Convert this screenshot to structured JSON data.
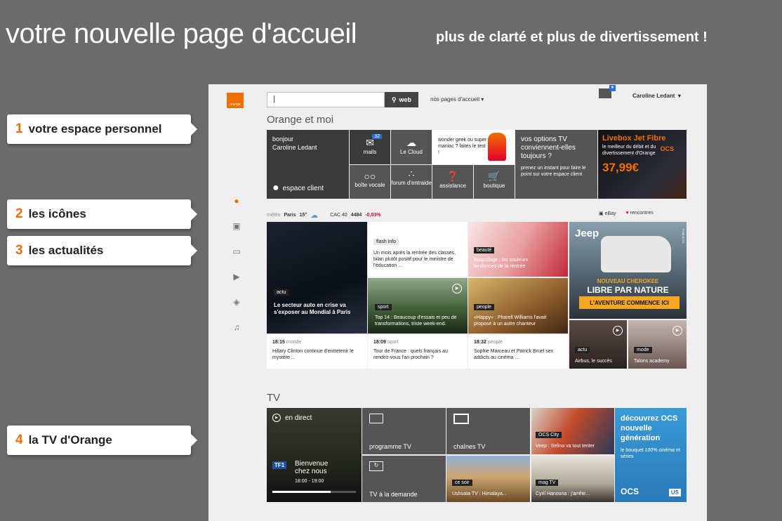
{
  "promo": {
    "title": "votre nouvelle page d'accueil",
    "subtitle": "plus de clarté et plus de divertissement !"
  },
  "callouts": [
    {
      "num": "1",
      "label": "votre espace personnel"
    },
    {
      "num": "2",
      "label": "les icônes"
    },
    {
      "num": "3",
      "label": "les actualités"
    },
    {
      "num": "4",
      "label": "la TV d'Orange"
    }
  ],
  "header": {
    "logo_text": "orange",
    "search_button": "web",
    "my_pages": "nos pages d'accueil",
    "user_name": "Caroline Ledant"
  },
  "orange_et_moi": {
    "title": "Orange et moi",
    "welcome": "bonjour",
    "welcome_name": "Caroline Ledant",
    "client_space": "espace client",
    "mails_label": "mails",
    "mails_count": "32",
    "cloud_label": "Le Cloud",
    "voicemail_label": "boîte vocale",
    "forum_label": "forum d'entraide",
    "assistance_label": "assistance",
    "shop_label": "boutique",
    "geek_text": "wonder geek ou super maniac ? faites le test !",
    "tv_options_title": "vos options TV conviennent-elles toujours ?",
    "tv_options_text": "prenez un instant pour faire le point sur votre espace client",
    "livebox_title": "Livebox Jet Fibre",
    "livebox_text": "le meilleur du débit et du divertissement d'Orange",
    "livebox_price": "37,99€",
    "livebox_brand": "OCS"
  },
  "ticker": {
    "weather_label": "météo",
    "weather_city": "Paris",
    "weather_temp": "15°",
    "index_label": "CAC 40",
    "index_value": "4484",
    "index_change": "-0,03%",
    "ebay": "eBay",
    "rencontres": "rencontres"
  },
  "news": {
    "main_tag": "actu",
    "main_text": "Le secteur auto en crise va s'exposer au Mondial à Paris",
    "flash_tag": "flash info",
    "flash_text": "Un mois après la rentrée des classes, bilan plutôt positif pour le ministre de l'éducation ...",
    "beauty_tag": "beauté",
    "beauty_text": "Maquillage : les couleurs tendances de la rentrée",
    "sport_tag": "sport",
    "sport_text": "Top 14 : Beaucoup d'essais et peu de transformations, triste week-end.",
    "people_tag": "people",
    "people_text": "«Happy» : Pharell Williams l'avait proposé à un autre chanteur",
    "jeep_brand": "Jeep",
    "jeep_line1": "NOUVEAU CHEROKEE",
    "jeep_line2": "LIBRE PAR NATURE",
    "jeep_cta": "L'AVENTURE COMMENCE ICI",
    "jeep_pub": "PUBLICITÉ",
    "items": [
      {
        "time": "18:15",
        "cat": "monde",
        "text": "Hillary Clinton continue d'entretenir le mystère ..."
      },
      {
        "time": "18:09",
        "cat": "sport",
        "text": "Tour de France : quels français au rendez-vous l'an prochain ?"
      },
      {
        "time": "18:32",
        "cat": "people",
        "text": "Sophie Marceau et Patrick Bruel sex addicts au cinéma ..."
      }
    ],
    "airbus_tag": "actu",
    "airbus_text": "Airbus, le succès",
    "mode_tag": "mode",
    "mode_text": "Talons academy"
  },
  "tv": {
    "title": "TV",
    "live_label": "en direct",
    "channel": "TF1",
    "show": "Bienvenue chez nous",
    "show_time": "18:00 - 19:00",
    "live_progress": 0.7,
    "programme": "programme TV",
    "chaines": "chaînes TV",
    "vod": "TV à la demande",
    "ocs_city_tag": "OCS City",
    "ocs_city_text": "Veep : Selina va tout tenter",
    "ce_soir_tag": "ce soir",
    "ce_soir_text": "Ushuaïa TV : Himalaya...",
    "mag_tag": "mag TV",
    "mag_text": "Cyril Hanouna : j'arrête...",
    "ocs_promo_title": "découvrez OCS nouvelle génération",
    "ocs_promo_text": "le bouquet 100% cinéma et séries",
    "ocs_logo": "OCS",
    "us_logo": "US"
  }
}
